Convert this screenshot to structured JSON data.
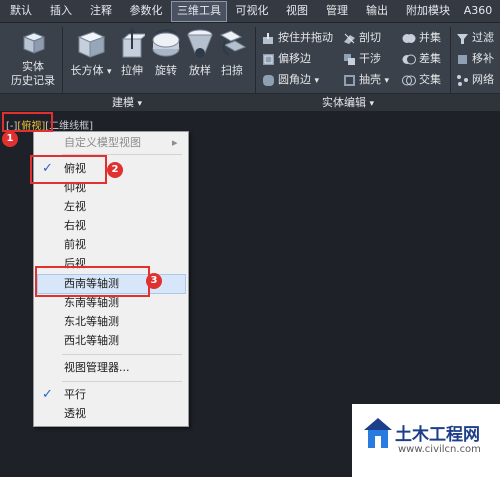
{
  "tabs": [
    "默认",
    "插入",
    "注释",
    "参数化",
    "三维工具",
    "可视化",
    "视图",
    "管理",
    "输出",
    "附加模块",
    "A360"
  ],
  "active_tab": "三维工具",
  "ribbon": {
    "history_label_1": "实体",
    "history_label_2": "历史记录",
    "box_label": "长方体",
    "box_arrow": "▾",
    "extrude_label": "拉伸",
    "revolve_label": "旋转",
    "loft_label": "放样",
    "sweep_label": "扫掠",
    "presspull_label": "按住并拖动",
    "offset_edge_label": "偏移边",
    "fillet_edge_label": "圆角边",
    "slice_label": "剖切",
    "interfere_label": "干涉",
    "shell_label": "抽壳",
    "union_label": "并集",
    "subtract_label": "差集",
    "intersect_label": "交集",
    "filter_label": "过滤",
    "move_label": "移补",
    "network_label": "网络",
    "modeling_panel": "建模",
    "solid_edit_panel": "实体编辑",
    "panel_arrow": "▾"
  },
  "viewport": {
    "label_minus": "[-]",
    "label_view": "[俯视]",
    "label_style": "[二维线框]"
  },
  "menu": {
    "custom_view": "自定义模型视图",
    "submenu_arrow": "▸",
    "views": [
      "俯视",
      "仰视",
      "左视",
      "右视",
      "前视",
      "后视"
    ],
    "iso_views": [
      "西南等轴测",
      "东南等轴测",
      "东北等轴测",
      "西北等轴测"
    ],
    "view_manager": "视图管理器...",
    "parallel": "平行",
    "perspective": "透视",
    "check": "✓"
  },
  "badges": [
    "1",
    "2",
    "3"
  ],
  "watermark": {
    "name": "土木工程网",
    "url": "www.civilcn.com"
  },
  "colors": {
    "background": "#1e2228",
    "ribbon": "#3b414a",
    "annotation_red": "#e03030",
    "check_blue": "#2a62c8",
    "view_label_yellow": "#f0c23a"
  }
}
